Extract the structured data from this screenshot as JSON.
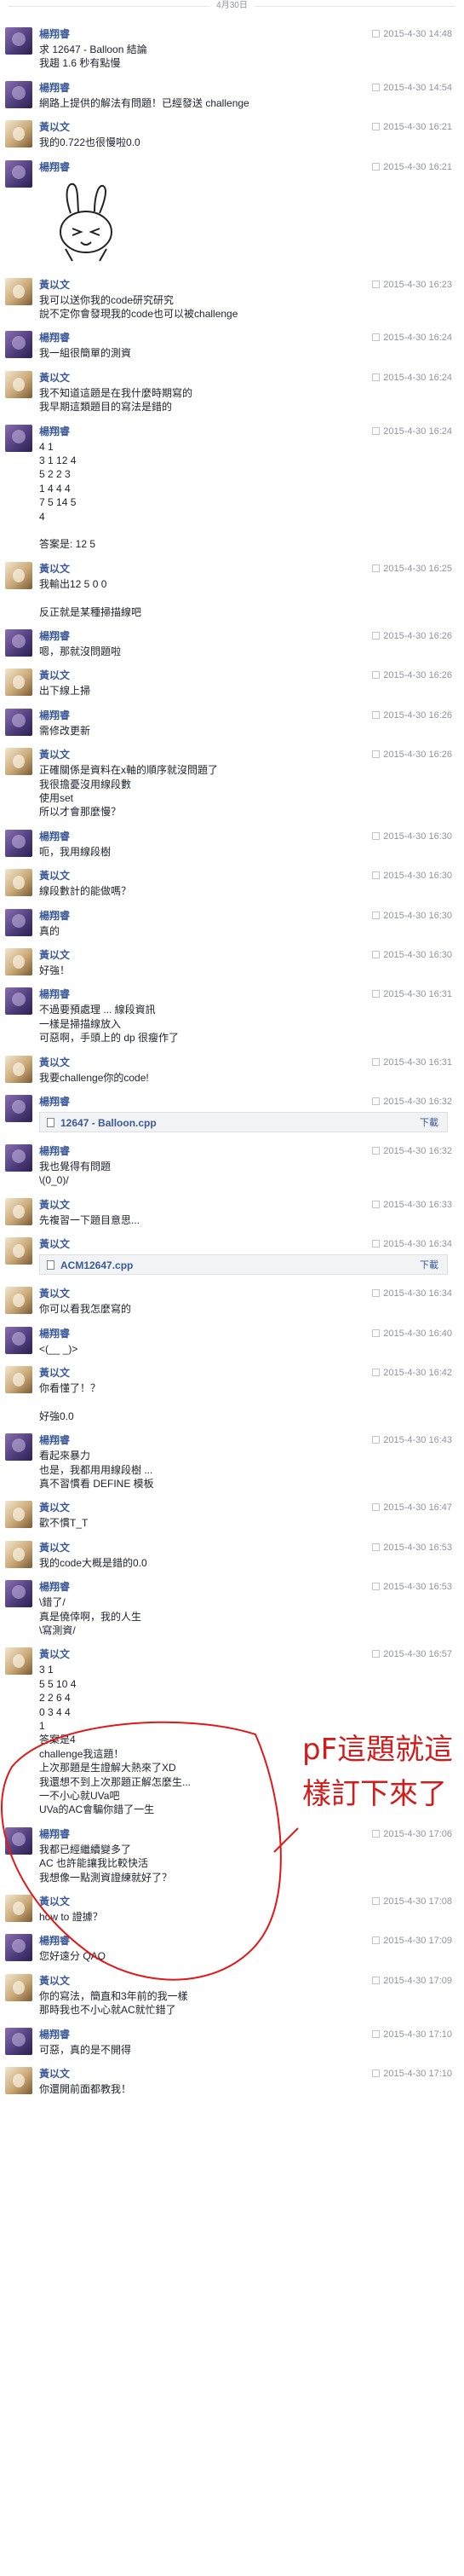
{
  "date_divider": "4月30日",
  "annotation": {
    "line1": "pF這題就這",
    "line2": "樣訂下來了"
  },
  "messages": [
    {
      "sender": "楊翔睿",
      "avatar": "purple",
      "time": "2015-4-30 14:48",
      "lines": [
        "求 12647 - Balloon 結論",
        "我趨 1.6 秒有點慢"
      ]
    },
    {
      "sender": "楊翔睿",
      "avatar": "purple",
      "time": "2015-4-30 14:54",
      "lines": [
        "網路上提供的解法有問題！已經發送 challenge"
      ]
    },
    {
      "sender": "黃以文",
      "avatar": "deer",
      "time": "2015-4-30 16:21",
      "lines": [
        "我的0.722也很慢啦0.0"
      ]
    },
    {
      "sender": "楊翔睿",
      "avatar": "purple",
      "time": "2015-4-30 16:21",
      "lines": [],
      "sticker": true
    },
    {
      "sender": "黃以文",
      "avatar": "deer",
      "time": "2015-4-30 16:23",
      "lines": [
        "我可以送你我的code研究研究",
        "說不定你會發現我的code也可以被challenge"
      ]
    },
    {
      "sender": "楊翔睿",
      "avatar": "purple",
      "time": "2015-4-30 16:24",
      "lines": [
        "我一組很簡單的測資"
      ]
    },
    {
      "sender": "黃以文",
      "avatar": "deer",
      "time": "2015-4-30 16:24",
      "lines": [
        "我不知道這題是在我什麼時期寫的",
        "我早期這類題目的寫法是錯的"
      ]
    },
    {
      "sender": "楊翔睿",
      "avatar": "purple",
      "time": "2015-4-30 16:24",
      "lines": [
        "4 1",
        "3 1 12 4",
        "5 2 2 3",
        "1 4 4 4",
        "7 5 14 5",
        "4",
        "",
        "答案是: 12 5"
      ]
    },
    {
      "sender": "黃以文",
      "avatar": "deer",
      "time": "2015-4-30 16:25",
      "lines": [
        "我輸出12 5 0 0",
        "",
        "反正就是某種掃描線吧"
      ]
    },
    {
      "sender": "楊翔睿",
      "avatar": "purple",
      "time": "2015-4-30 16:26",
      "lines": [
        "嗯，那就沒問題啦"
      ]
    },
    {
      "sender": "黃以文",
      "avatar": "deer",
      "time": "2015-4-30 16:26",
      "lines": [
        "出下線上掃"
      ]
    },
    {
      "sender": "楊翔睿",
      "avatar": "purple",
      "time": "2015-4-30 16:26",
      "lines": [
        "需修改更新"
      ]
    },
    {
      "sender": "黃以文",
      "avatar": "deer",
      "time": "2015-4-30 16:26",
      "lines": [
        "正確關係是資料在x軸的順序就沒問題了",
        "我很擔憂沒用線段數",
        "使用set",
        "所以才會那麼慢？"
      ]
    },
    {
      "sender": "楊翔睿",
      "avatar": "purple",
      "time": "2015-4-30 16:30",
      "lines": [
        "呃，我用線段樹"
      ]
    },
    {
      "sender": "黃以文",
      "avatar": "deer",
      "time": "2015-4-30 16:30",
      "lines": [
        "線段數計的能做嗎？"
      ]
    },
    {
      "sender": "楊翔睿",
      "avatar": "purple",
      "time": "2015-4-30 16:30",
      "lines": [
        "真的"
      ]
    },
    {
      "sender": "黃以文",
      "avatar": "deer",
      "time": "2015-4-30 16:30",
      "lines": [
        "好強！"
      ]
    },
    {
      "sender": "楊翔睿",
      "avatar": "purple",
      "time": "2015-4-30 16:31",
      "lines": [
        "不過要預處理 ... 線段資訊",
        "一樣是掃描線放入",
        "可惡啊，手頭上的 dp 很瘦作了"
      ]
    },
    {
      "sender": "黃以文",
      "avatar": "deer",
      "time": "2015-4-30 16:31",
      "lines": [
        "我要challenge你的code!"
      ]
    },
    {
      "sender": "楊翔睿",
      "avatar": "purple",
      "time": "2015-4-30 16:32",
      "lines": [],
      "file": {
        "name": "12647 - Balloon.cpp",
        "download": "下載"
      }
    },
    {
      "sender": "楊翔睿",
      "avatar": "purple",
      "time": "2015-4-30 16:32",
      "lines": [
        "我也覺得有問題",
        "\\(0_0)/"
      ]
    },
    {
      "sender": "黃以文",
      "avatar": "deer",
      "time": "2015-4-30 16:33",
      "lines": [
        "先複習一下題目意思..."
      ]
    },
    {
      "sender": "黃以文",
      "avatar": "deer",
      "time": "2015-4-30 16:34",
      "lines": [],
      "file": {
        "name": "ACM12647.cpp",
        "download": "下載"
      }
    },
    {
      "sender": "黃以文",
      "avatar": "deer",
      "time": "2015-4-30 16:34",
      "lines": [
        "你可以看我怎麼寫的"
      ]
    },
    {
      "sender": "楊翔睿",
      "avatar": "purple",
      "time": "2015-4-30 16:40",
      "lines": [
        "<(__ _)>"
      ]
    },
    {
      "sender": "黃以文",
      "avatar": "deer",
      "time": "2015-4-30 16:42",
      "lines": [
        "你看懂了！？",
        "",
        "好強0.0"
      ]
    },
    {
      "sender": "楊翔睿",
      "avatar": "purple",
      "time": "2015-4-30 16:43",
      "lines": [
        "看起來暴力",
        "也是，我都用用線段樹 ...",
        "真不習慣看 DEFINE 模板"
      ]
    },
    {
      "sender": "黃以文",
      "avatar": "deer",
      "time": "2015-4-30 16:47",
      "lines": [
        "歡不慣T_T"
      ]
    },
    {
      "sender": "黃以文",
      "avatar": "deer",
      "time": "2015-4-30 16:53",
      "lines": [
        "我的code大概是錯的0.0"
      ]
    },
    {
      "sender": "楊翔睿",
      "avatar": "purple",
      "time": "2015-4-30 16:53",
      "lines": [
        "\\錯了/",
        "真是僥倖啊，我的人生",
        "\\寫測資/"
      ]
    },
    {
      "sender": "黃以文",
      "avatar": "deer",
      "time": "2015-4-30 16:57",
      "lines": [
        "3 1",
        "5 5 10 4",
        "2 2 6 4",
        "0 3 4 4",
        "1",
        "答案是4",
        "challenge我這題！",
        "上次那題是生證解大熱來了XD",
        "我還想不到上次那題正解怎麼生...",
        "一不小心就UVa吧",
        "UVa的AC會騙你錯了一生"
      ]
    },
    {
      "sender": "楊翔睿",
      "avatar": "purple",
      "time": "2015-4-30 17:06",
      "lines": [
        "我都已經繼續變多了",
        "AC 也許能讓我比較快活",
        "我想像一點測資證練就好了？"
      ]
    },
    {
      "sender": "黃以文",
      "avatar": "deer",
      "time": "2015-4-30 17:08",
      "lines": [
        "how to 證據？"
      ]
    },
    {
      "sender": "楊翔睿",
      "avatar": "purple",
      "time": "2015-4-30 17:09",
      "lines": [
        "您好遠分 QAQ"
      ]
    },
    {
      "sender": "黃以文",
      "avatar": "deer",
      "time": "2015-4-30 17:09",
      "lines": [
        "你的寫法，簡直和3年前的我一樣",
        "那時我也不小心就AC就忙錯了"
      ]
    },
    {
      "sender": "楊翔睿",
      "avatar": "purple",
      "time": "2015-4-30 17:10",
      "lines": [
        "可惡，真的是不開得"
      ]
    },
    {
      "sender": "黃以文",
      "avatar": "deer",
      "time": "2015-4-30 17:10",
      "lines": [
        "你還開前面都教我！"
      ]
    }
  ]
}
